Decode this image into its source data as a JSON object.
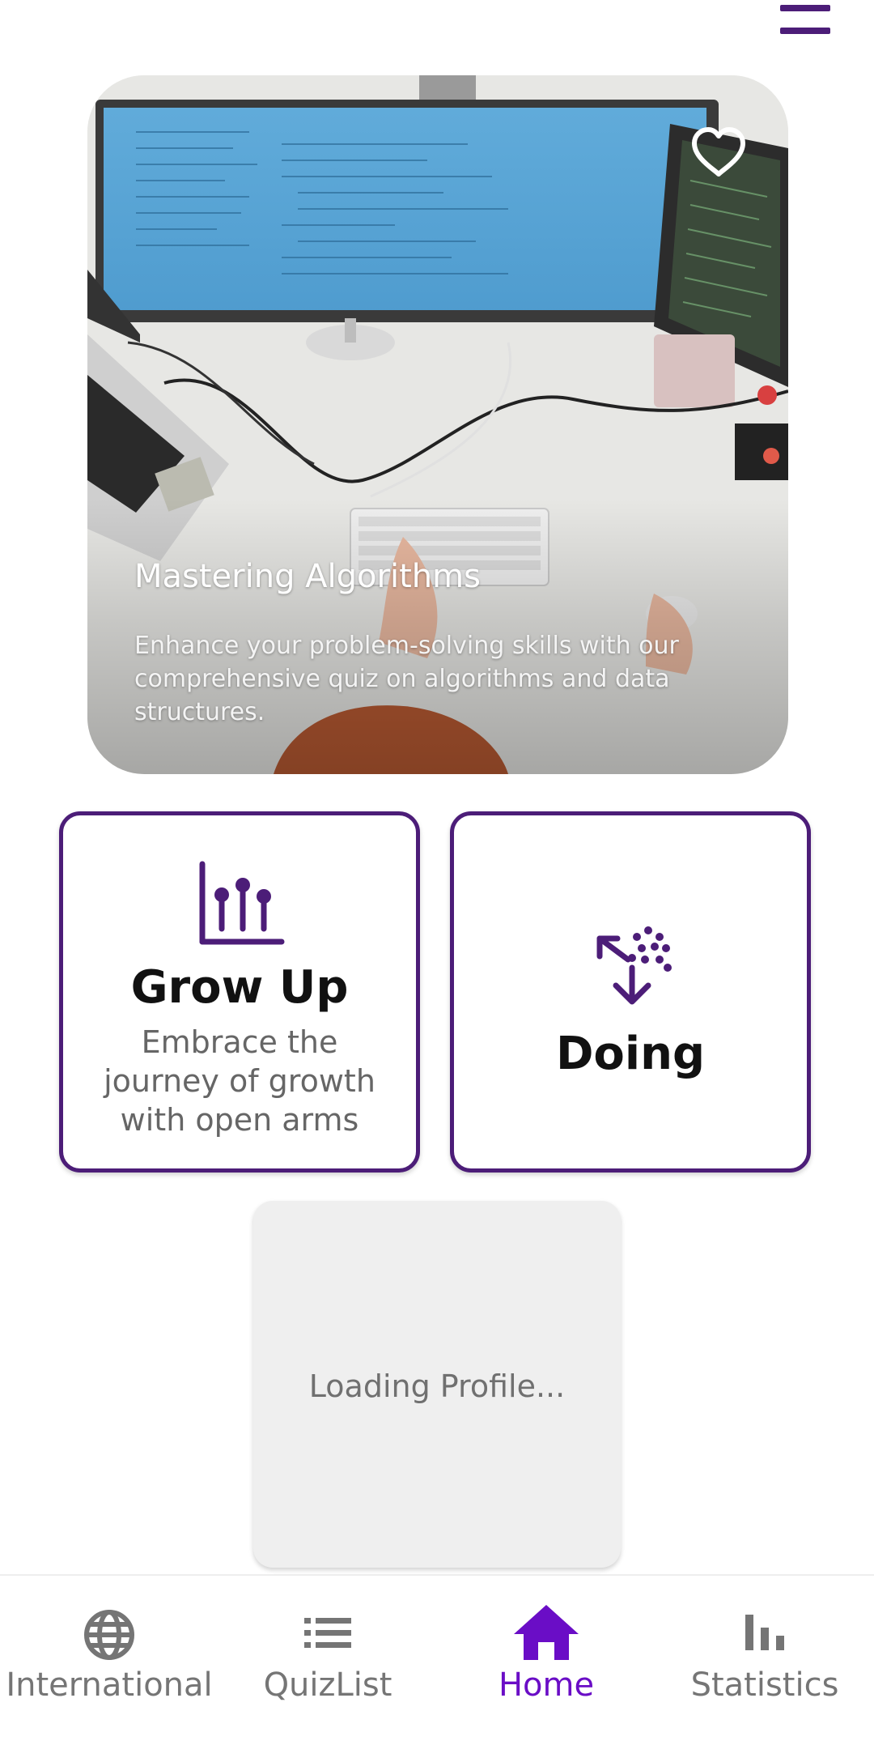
{
  "header": {
    "menu_icon": "menu-icon",
    "menu_color": "#4c1d78"
  },
  "hero": {
    "title": "Mastering Algorithms",
    "description": "Enhance your problem-solving skills with our comprehensive quiz on algorithms and data structures.",
    "favorite_icon": "heart-outline-icon",
    "image": "desk-computer-photo"
  },
  "cards": [
    {
      "title": "Grow Up",
      "subtitle": "Embrace the journey of growth with open arms",
      "icon": "bar-chart-pins-icon"
    },
    {
      "title": "Doing",
      "icon": "scatter-arrows-icon"
    }
  ],
  "profile": {
    "loading_text": "Loading Profile..."
  },
  "bottom_nav": {
    "items": [
      {
        "label": "International",
        "icon": "globe-icon",
        "active": false
      },
      {
        "label": "QuizList",
        "icon": "list-icon",
        "active": false
      },
      {
        "label": "Home",
        "icon": "home-icon",
        "active": true
      },
      {
        "label": "Statistics",
        "icon": "bar-chart-icon",
        "active": false
      }
    ],
    "active_color": "#6a0dc6",
    "inactive_color": "#757575"
  },
  "colors": {
    "accent": "#4c1d78",
    "background": "#ffffff",
    "placeholder": "#efefef"
  }
}
